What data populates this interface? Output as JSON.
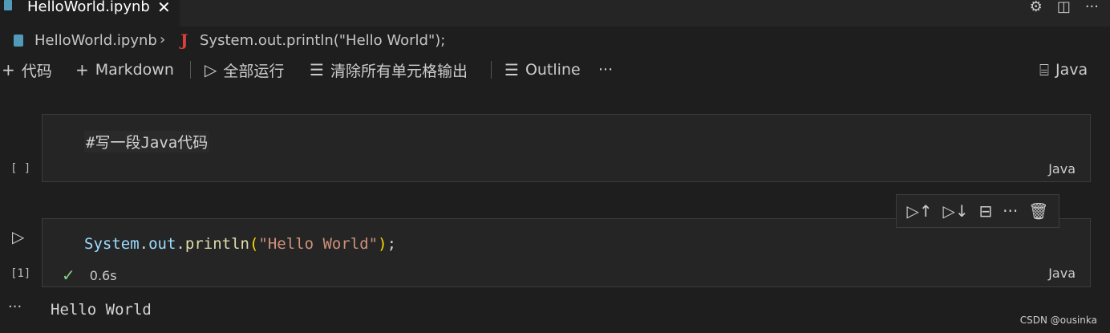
{
  "tab": {
    "title": "HelloWorld.ipynb",
    "close": "✕"
  },
  "tab_actions": {
    "settings": "⚙",
    "split": "◫",
    "more": "···"
  },
  "breadcrumb": {
    "file": "HelloWorld.ipynb",
    "separator": "›",
    "symbol_icon": "J",
    "symbol": "System.out.println(\"Hello World\");"
  },
  "toolbar": {
    "add_code": "代码",
    "add_markdown": "Markdown",
    "run_all": "全部运行",
    "clear_outputs": "清除所有单元格输出",
    "outline": "Outline",
    "more": "···",
    "kernel": "Java"
  },
  "cells": [
    {
      "type": "markdown",
      "source": "#写一段Java代码",
      "exec_count": "[ ]",
      "language": "Java"
    },
    {
      "type": "code",
      "tokens": {
        "cls": "System",
        "dot1": ".",
        "field": "out",
        "dot2": ".",
        "fn": "println",
        "lp": "(",
        "str": "\"Hello World\"",
        "rp": ")",
        "semi": ";"
      },
      "exec_count": "[1]",
      "status_icon": "✓",
      "duration": "0.6s",
      "language": "Java",
      "output_more": "···",
      "output": "Hello World"
    }
  ],
  "cell_toolbar": {
    "run_above": "▷↑",
    "run_below": "▷↓",
    "split": "⊟",
    "more": "···",
    "delete": "🗑"
  },
  "watermark": "CSDN @ousinka"
}
